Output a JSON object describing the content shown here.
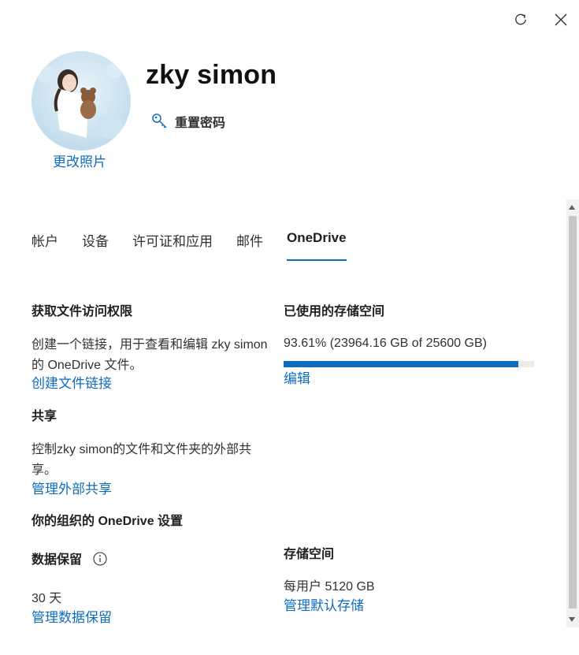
{
  "icons": {
    "refresh": "refresh-icon",
    "close": "close-icon",
    "key": "key-icon",
    "info": "info-icon"
  },
  "profile": {
    "name": "zky simon",
    "change_photo": "更改照片",
    "reset_password": "重置密码"
  },
  "tabs": [
    "帐户",
    "设备",
    "许可证和应用",
    "邮件",
    "OneDrive"
  ],
  "active_tab": "OneDrive",
  "access": {
    "title": "获取文件访问权限",
    "description": "创建一个链接，用于查看和编辑 zky simon 的 OneDrive 文件。",
    "link": "创建文件链接"
  },
  "sharing": {
    "title": "共享",
    "description": "控制zky simon的文件和文件夹的外部共享。",
    "link": "管理外部共享"
  },
  "org_settings": {
    "title": "你的组织的 OneDrive 设置"
  },
  "retention": {
    "title": "数据保留",
    "value": "30 天",
    "link": "管理数据保留"
  },
  "storage_used": {
    "title": "已使用的存储空间",
    "text": "93.61% (23964.16 GB of 25600 GB)",
    "percent": 93.61,
    "link": "编辑"
  },
  "storage_space": {
    "title": "存储空间",
    "text": "每用户 5120 GB",
    "link": "管理默认存储"
  },
  "colors": {
    "accent": "#0f6cbd",
    "text": "#201f1e",
    "track": "#edebe9"
  }
}
